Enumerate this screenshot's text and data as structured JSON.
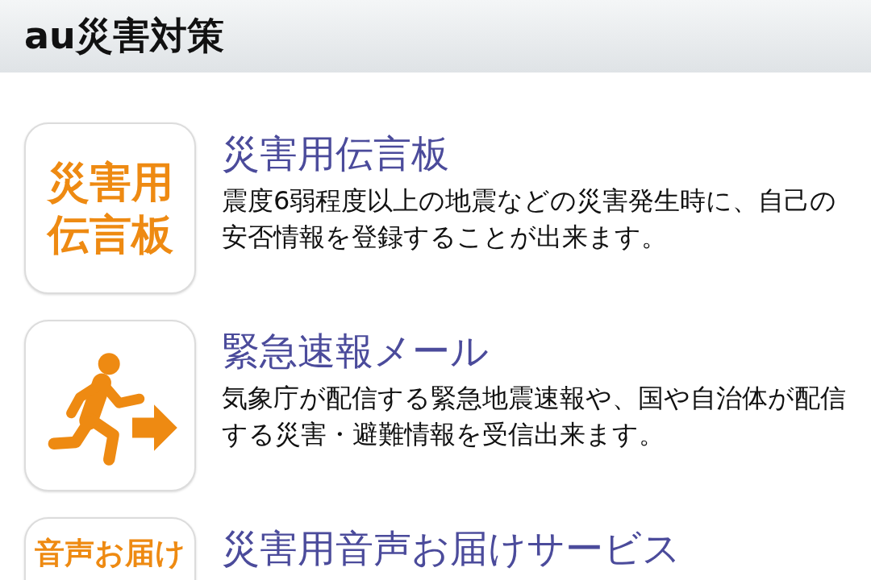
{
  "header": {
    "title": "au災害対策"
  },
  "items": [
    {
      "icon": {
        "kind": "text",
        "lines": [
          "災害用",
          "伝言板"
        ]
      },
      "title": "災害用伝言板",
      "description": "震度6弱程度以上の地震などの災害発生時に、自己の安否情報を登録することが出来ます。"
    },
    {
      "icon": {
        "kind": "runner"
      },
      "title": "緊急速報メール",
      "description": "気象庁が配信する緊急地震速報や、国や自治体が配信する災害・避難情報を受信出来ます。"
    },
    {
      "icon": {
        "kind": "text",
        "lines": [
          "音声お届け"
        ]
      },
      "title": "災害用音声お届けサービス"
    }
  ]
}
